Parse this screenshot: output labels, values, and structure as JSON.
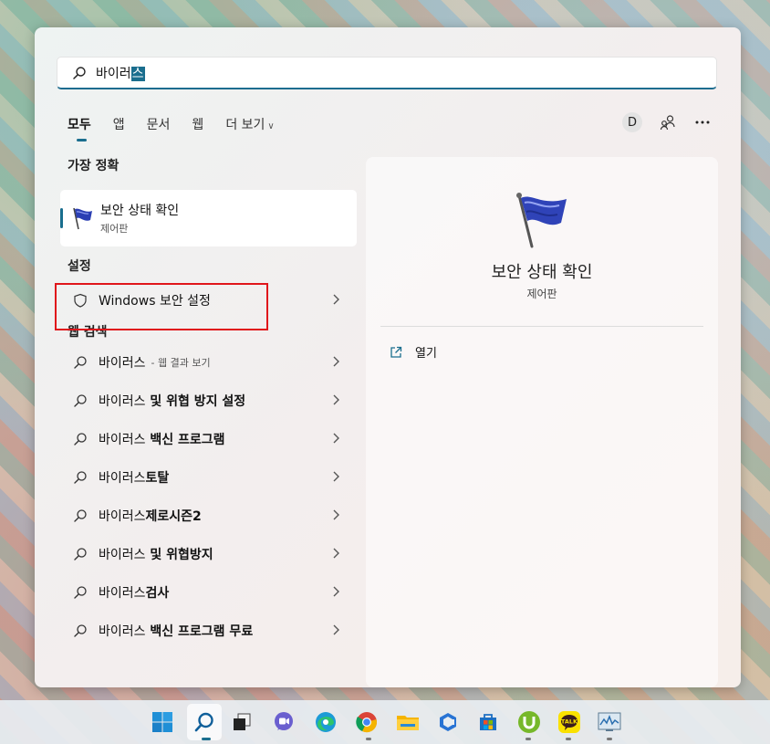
{
  "search": {
    "text": "바이러",
    "selected": "스"
  },
  "tabs": [
    {
      "label": "모두",
      "active": true
    },
    {
      "label": "앱"
    },
    {
      "label": "문서"
    },
    {
      "label": "웹"
    },
    {
      "label": "더 보기"
    }
  ],
  "header": {
    "avatar_letter": "D"
  },
  "best_match": {
    "section_title": "가장 정확",
    "title": "보안 상태 확인",
    "subtitle": "제어판"
  },
  "settings": {
    "section_title": "설정",
    "item_label": "Windows 보안 설정"
  },
  "web": {
    "section_title": "웹 검색",
    "first": {
      "prefix": "바이러스",
      "suffix": "- 웹 결과 보기"
    },
    "items": [
      {
        "prefix": "바이러스",
        "bold": " 및 위협 방지 설정"
      },
      {
        "prefix": "바이러스",
        "bold": " 백신 프로그램"
      },
      {
        "prefix": "바이러스",
        "bold": "토탈"
      },
      {
        "prefix": "바이러스",
        "bold": "제로시즌2"
      },
      {
        "prefix": "바이러스",
        "bold": " 및 위협방지"
      },
      {
        "prefix": "바이러스",
        "bold": "검사"
      },
      {
        "prefix": "바이러스",
        "bold": " 백신 프로그램 무료"
      }
    ]
  },
  "detail": {
    "title": "보안 상태 확인",
    "subtitle": "제어판",
    "open_label": "열기"
  },
  "colors": {
    "accent": "#1a6e8e",
    "highlight_box": "#e0161b"
  },
  "taskbar": {
    "apps": [
      "windows-start-icon",
      "search-icon",
      "task-view-icon",
      "teams-chat-icon",
      "edge-icon",
      "chrome-icon",
      "file-explorer-icon",
      "app-icon",
      "store-icon",
      "utorrent-icon",
      "kakaotalk-icon",
      "performance-monitor-icon"
    ],
    "kakao_label": "TALK"
  }
}
